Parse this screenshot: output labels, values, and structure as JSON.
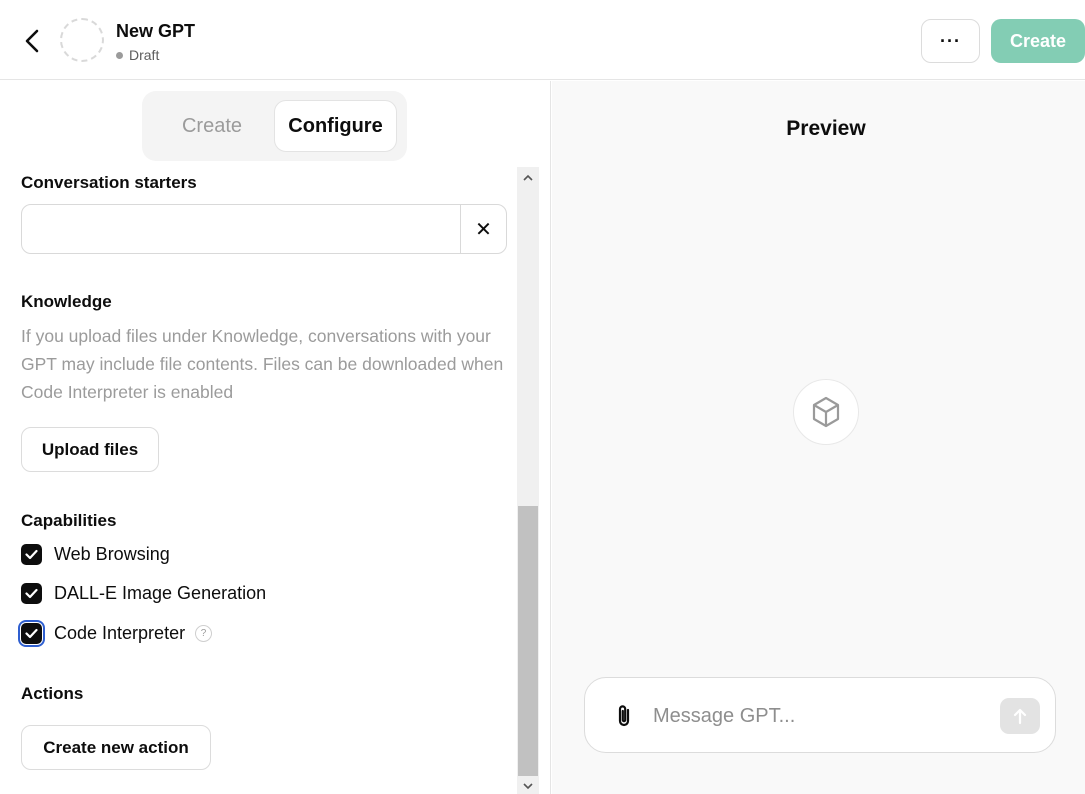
{
  "header": {
    "gpt_name": "New GPT",
    "status": "Draft",
    "more_label": "···",
    "create_label": "Create"
  },
  "tabs": [
    {
      "label": "Create",
      "active": false
    },
    {
      "label": "Configure",
      "active": true
    }
  ],
  "conversation_starters": {
    "title": "Conversation starters",
    "items": [
      {
        "value": "",
        "placeholder": ""
      }
    ],
    "clear_label": "✕"
  },
  "knowledge": {
    "title": "Knowledge",
    "description": "If you upload files under Knowledge, conversations with your GPT may include file contents. Files can be downloaded when Code Interpreter is enabled",
    "upload_label": "Upload files"
  },
  "capabilities": {
    "title": "Capabilities",
    "items": [
      {
        "label": "Web Browsing",
        "checked": true
      },
      {
        "label": "DALL-E Image Generation",
        "checked": true
      },
      {
        "label": "Code Interpreter",
        "checked": true,
        "help": "?"
      }
    ]
  },
  "actions": {
    "title": "Actions",
    "create_label": "Create new action"
  },
  "preview": {
    "title": "Preview",
    "icon": "cube-icon",
    "message_placeholder": "Message GPT..."
  },
  "colors": {
    "create_button": "#83cdb4",
    "checkbox": "#0d0d0d",
    "focus_ring": "#2f5fd0",
    "muted_text": "#9b9b9b"
  }
}
